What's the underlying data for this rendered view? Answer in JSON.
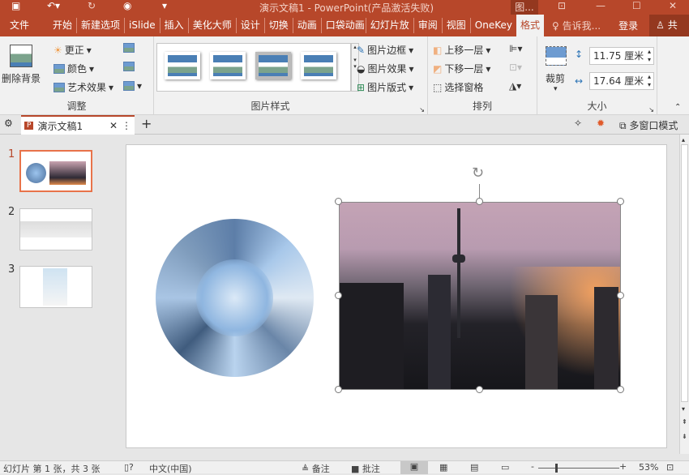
{
  "title": "演示文稿1 - PowerPoint(产品激活失败)",
  "context_tab": "图...",
  "tabs": [
    "文件",
    "开始",
    "新建选项",
    "iSlide",
    "插入",
    "美化大师",
    "设计",
    "切换",
    "动画",
    "口袋动画",
    "幻灯片放",
    "审阅",
    "视图",
    "OneKey",
    "格式"
  ],
  "tell_me": "告诉我...",
  "login": "登录",
  "share": "共享",
  "ribbon": {
    "remove_bg": "删除背景",
    "corrections": "更正",
    "color": "颜色",
    "art_effects": "艺术效果",
    "adjust_label": "调整",
    "styles_label": "图片样式",
    "border": "图片边框",
    "effects": "图片效果",
    "layout": "图片版式",
    "bring_forward": "上移一层",
    "send_backward": "下移一层",
    "selection_pane": "选择窗格",
    "arrange_label": "排列",
    "crop": "裁剪",
    "height": "11.75 厘米",
    "width": "17.64 厘米",
    "size_label": "大小"
  },
  "doc_tab": "演示文稿1",
  "multiwindow": "多窗口模式",
  "slides": [
    {
      "num": "1"
    },
    {
      "num": "2"
    },
    {
      "num": "3"
    }
  ],
  "status": {
    "slide_info": "幻灯片 第 1 张，共 3 张",
    "language": "中文(中国)",
    "notes": "备注",
    "comments": "批注",
    "zoom": "53%"
  },
  "zoom_percent": 53
}
